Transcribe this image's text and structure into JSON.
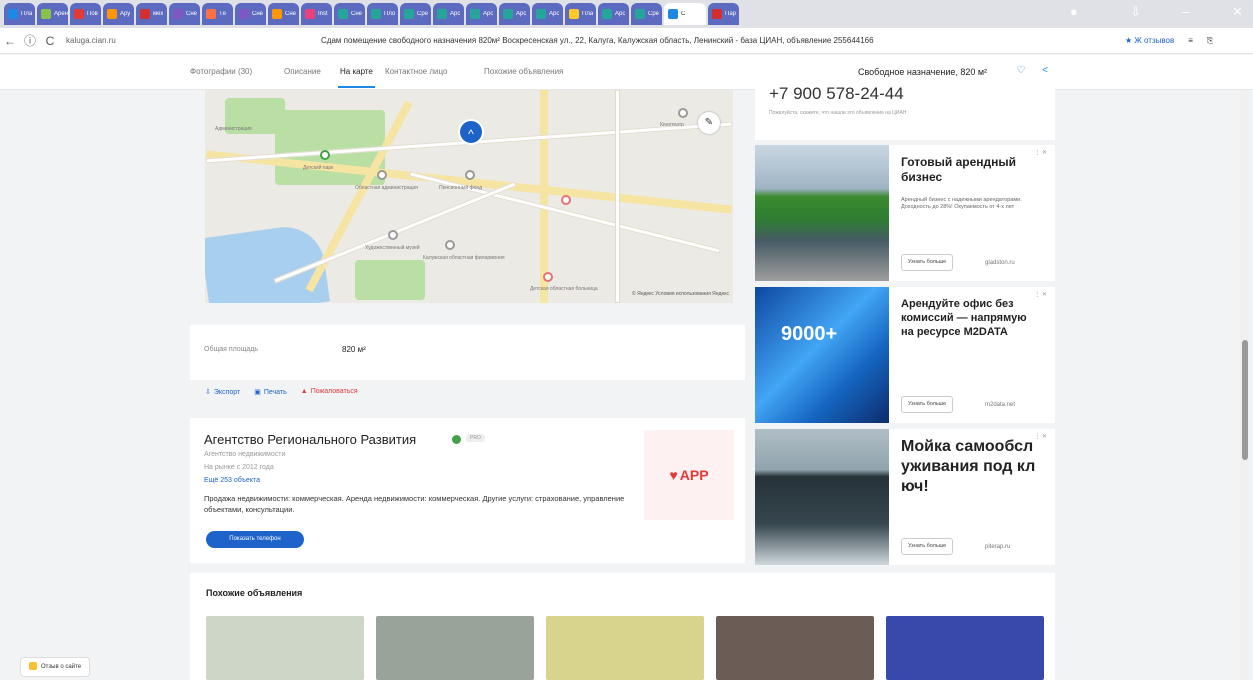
{
  "browser": {
    "tabs": [
      {
        "label": "Пла",
        "color": "#1e88e5"
      },
      {
        "label": "Арен",
        "color": "#8bc34a"
      },
      {
        "label": "Пов",
        "color": "#e53935"
      },
      {
        "label": "Ару",
        "color": "#ff9800"
      },
      {
        "label": "мех",
        "color": "#d32f2f"
      },
      {
        "label": "Сне",
        "color": "#7e57c2"
      },
      {
        "label": "Тё",
        "color": "#ff7043"
      },
      {
        "label": "Сне",
        "color": "#7e57c2"
      },
      {
        "label": "Сне",
        "color": "#ff9800"
      },
      {
        "label": "Inst",
        "color": "#ec407a"
      },
      {
        "label": "Сне",
        "color": "#26a69a"
      },
      {
        "label": "Пло",
        "color": "#26a69a"
      },
      {
        "label": "Сре",
        "color": "#26a69a"
      },
      {
        "label": "Арс",
        "color": "#26a69a"
      },
      {
        "label": "Арс",
        "color": "#26a69a"
      },
      {
        "label": "Арс",
        "color": "#26a69a"
      },
      {
        "label": "Арс",
        "color": "#26a69a"
      },
      {
        "label": "Пла",
        "color": "#ffca28"
      },
      {
        "label": "Арс",
        "color": "#26a69a"
      },
      {
        "label": "Сре",
        "color": "#26a69a"
      },
      {
        "label": "С",
        "color": "#1e88e5"
      },
      {
        "label": "Пар",
        "color": "#d32f2f"
      }
    ],
    "url_host": "kaluga.cian.ru",
    "page_title": "Сдам помещение свободного назначения 820м² Воскресенская ул., 22, Калуга, Калужская область, Ленинский - база ЦИАН, объявление 255644166",
    "notes_label": "★ Ж отзывов",
    "nav_back": "←",
    "nav_info": "ⓘ",
    "nav_reload": "C"
  },
  "subnav": {
    "items": [
      "Фотографии (30)",
      "Описание",
      "На карте",
      "Контактное лицо",
      "Похожие объявления"
    ],
    "active_index": 2,
    "price_summary": "Свободное назначение, 820 м²"
  },
  "map": {
    "labels": [
      "Детский парк",
      "Администрация",
      "Областная администрация",
      "Пенсионный фонд",
      "Кинотеатр",
      "Детская областная больница",
      "Художественный музей",
      "Калужская областная филармония"
    ],
    "attribution": "© Яндекс Условия использования Яндекс"
  },
  "area": {
    "label": "Общая площадь",
    "value": "820 м²"
  },
  "actions": {
    "export": "Экспорт",
    "print": "Печать",
    "complain": "Пожаловаться"
  },
  "agency": {
    "name": "Агентство Регионального Развития",
    "pro_label": "PRO",
    "type": "Агентство недвижимости",
    "since": "На рынке с 2012 года",
    "objects": "Ещё 253 объекта",
    "description": "Продажа недвижимости: коммерческая. Аренда недвижимости: коммерческая. Другие услуги: страхование, управление объектами, консультации.",
    "show_phone": "Показать телефон",
    "logo_text": "АРР"
  },
  "contact": {
    "phone": "+7 900 578-24-44",
    "note": "Пожалуйста, скажите, что нашли это объявление на ЦИАН"
  },
  "ads": [
    {
      "title": "Готовый арендный бизнес",
      "text": "Арендный бизнес с надежными арендаторами. Доходность до 28%! Окупаемость от 4-х лет",
      "button": "Узнать больше",
      "domain": "gladston.ru"
    },
    {
      "title": "Арендуйте офис без комиссий — напрямую на ресурсе M2DATA",
      "text": "",
      "button": "Узнать больше",
      "domain": "m2data.net",
      "image_text": "9000+"
    },
    {
      "title": "Мойка самообслуживания под ключ!",
      "text": "",
      "button": "Узнать больше",
      "domain": "piterap.ru"
    }
  ],
  "ad_marker": "⋮ ✕",
  "similar": {
    "title": "Похожие объявления",
    "thumb_colors": [
      "#cdd6c7",
      "#9aa39a",
      "#d8d48d",
      "#6b5d55",
      "#3949ab"
    ]
  },
  "feedback": {
    "label": "Отзыв о сайте"
  }
}
